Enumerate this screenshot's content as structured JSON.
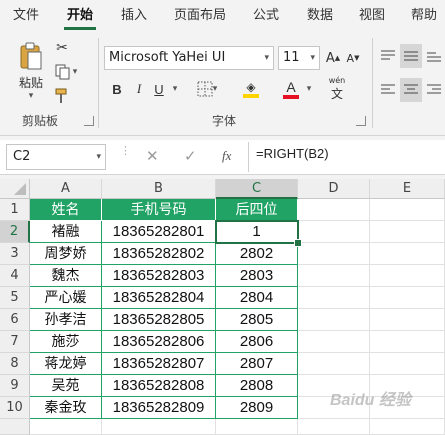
{
  "menu": {
    "tabs": [
      "文件",
      "开始",
      "插入",
      "页面布局",
      "公式",
      "数据",
      "视图",
      "帮助"
    ],
    "active": "开始"
  },
  "ribbon": {
    "clipboard": {
      "paste_label": "粘贴",
      "group_label": "剪贴板"
    },
    "font": {
      "name": "Microsoft YaHei UI",
      "size": "11",
      "group_label": "字体",
      "bold": "B",
      "italic": "I",
      "underline": "U",
      "font_color": "#e81123",
      "fill_color": "#ffd400"
    }
  },
  "formula_bar": {
    "name_box": "C2",
    "fx": "fx",
    "formula": "=RIGHT(B2)"
  },
  "sheet": {
    "columns": [
      "A",
      "B",
      "C",
      "D",
      "E"
    ],
    "rows": [
      "1",
      "2",
      "3",
      "4",
      "5",
      "6",
      "7",
      "8",
      "9",
      "10"
    ],
    "header_color": "#21a366",
    "headers": [
      "姓名",
      "手机号码",
      "后四位"
    ],
    "data": [
      [
        "褚融",
        "18365282801",
        "1"
      ],
      [
        "周梦娇",
        "18365282802",
        "2802"
      ],
      [
        "魏杰",
        "18365282803",
        "2803"
      ],
      [
        "严心媛",
        "18365282804",
        "2804"
      ],
      [
        "孙孝洁",
        "18365282805",
        "2805"
      ],
      [
        "施莎",
        "18365282806",
        "2806"
      ],
      [
        "蒋龙婷",
        "18365282807",
        "2807"
      ],
      [
        "吴苑",
        "18365282808",
        "2808"
      ],
      [
        "秦金玫",
        "18365282809",
        "2809"
      ]
    ],
    "selected_cell": "C2"
  },
  "watermark": "Baidu 经验"
}
